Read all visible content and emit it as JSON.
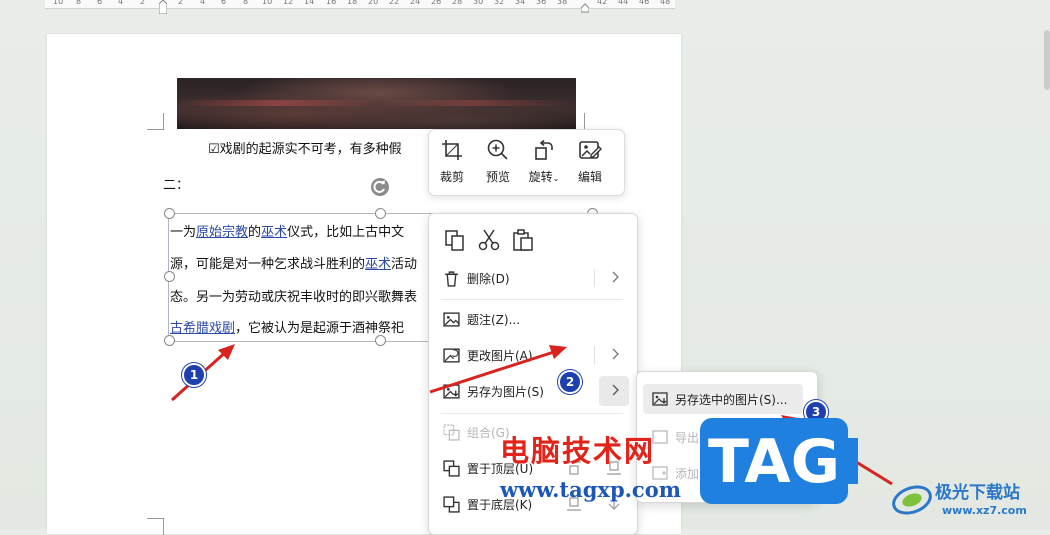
{
  "ruler": {
    "numbers": [
      "10",
      "8",
      "6",
      "4",
      "2",
      "2",
      "4",
      "6",
      "8",
      "10",
      "12",
      "14",
      "16",
      "18",
      "20",
      "22",
      "24",
      "26",
      "28",
      "30",
      "32",
      "34",
      "36",
      "38",
      "42",
      "44",
      "46",
      "48"
    ]
  },
  "document": {
    "caption_line": "☑戏剧的起源实不可考，有多种假",
    "heading_line": "二：",
    "para": {
      "l1_a": "一为",
      "l1_link1": "原始宗教",
      "l1_b": "的",
      "l1_link2": "巫术",
      "l1_c": "仪式，比如上古中文",
      "l2_a": "源，可能是对一种乞求战斗胜利的",
      "l2_link": "巫术",
      "l2_b": "活动",
      "l3": "态。另一为劳动或庆祝丰收时的即兴歌舞表",
      "l4_link": "古希腊戏剧",
      "l4_b": "，它被认为是起源于酒神祭祀"
    }
  },
  "toolbar": {
    "crop": "裁剪",
    "preview": "预览",
    "rotate": "旋转",
    "edit": "编辑"
  },
  "context_menu": {
    "delete": "删除(D)",
    "caption": "题注(Z)...",
    "change_picture": "更改图片(A)",
    "save_as_picture": "另存为图片(S)",
    "group": "组合(G)",
    "bring_to_front": "置于顶层(U)",
    "send_to_back": "置于底层(K)"
  },
  "submenu": {
    "save_selected": "另存选中的图片(S)...",
    "save_all": "导出文档中所有图片",
    "add_to_assets": "添加到资源库"
  },
  "annotations": {
    "step1": "1",
    "step2": "2",
    "step3": "3"
  },
  "watermark": {
    "cn_text": "电脑技术网",
    "url_text": "www.tagxp.com",
    "tag_text": "TAG",
    "jg_name": "极光下载站",
    "jg_url": "www.xz7.com"
  },
  "colors": {
    "badge": "#1e3fae",
    "arrow": "#d9231f",
    "link": "#2b4aa8",
    "tag_bg": "#1f80e0",
    "wm_red": "#e2231a"
  }
}
